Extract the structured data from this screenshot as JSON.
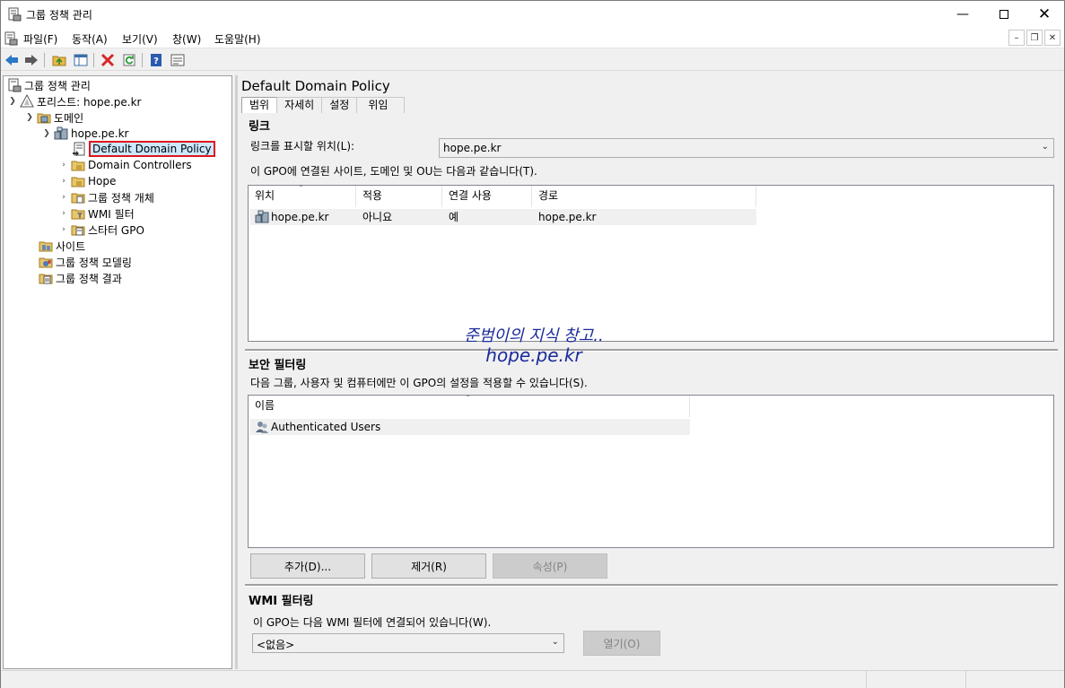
{
  "window": {
    "title": "그룹 정책 관리"
  },
  "menu": [
    "파일(F)",
    "동작(A)",
    "보기(V)",
    "창(W)",
    "도움말(H)"
  ],
  "toolbar_icons": [
    "back-icon",
    "forward-icon",
    "up-folder-icon",
    "show-hide-tree-icon",
    "delete-icon",
    "refresh-icon",
    "help-icon",
    "properties-icon"
  ],
  "tree": {
    "root": "그룹 정책 관리",
    "forest": "포리스트: hope.pe.kr",
    "domains": "도메인",
    "domain": "hope.pe.kr",
    "selected": "Default Domain Policy",
    "children": [
      "Domain Controllers",
      "Hope",
      "그룹 정책 개체",
      "WMI 필터",
      "스타터 GPO"
    ],
    "sites": "사이트",
    "modeling": "그룹 정책 모델링",
    "results": "그룹 정책 결과"
  },
  "gpo": {
    "title": "Default Domain Policy",
    "tabs": [
      "범위",
      "자세히",
      "설정",
      "위임"
    ]
  },
  "links": {
    "heading": "링크",
    "location_label": "링크를 표시할 위치(L):",
    "location_value": "hope.pe.kr",
    "description": "이 GPO에 연결된 사이트, 도메인 및 OU는 다음과 같습니다(T).",
    "columns": [
      "위치",
      "적용",
      "연결 사용",
      "경로"
    ],
    "rows": [
      {
        "location": "hope.pe.kr",
        "enforced": "아니요",
        "enabled": "예",
        "path": "hope.pe.kr"
      }
    ]
  },
  "security": {
    "heading": "보안 필터링",
    "description": "다음 그룹, 사용자 및 컴퓨터에만 이 GPO의 설정을 적용할 수 있습니다(S).",
    "columns": [
      "이름"
    ],
    "rows": [
      "Authenticated Users"
    ],
    "add": "추가(D)...",
    "remove": "제거(R)",
    "properties": "속성(P)"
  },
  "wmi": {
    "heading": "WMI 필터링",
    "description": "이 GPO는 다음 WMI 필터에 연결되어 있습니다(W).",
    "value": "<없음>",
    "open": "열기(O)"
  },
  "watermark": {
    "line1": "준범이의 지식 창고..",
    "line2": "hope.pe.kr"
  }
}
